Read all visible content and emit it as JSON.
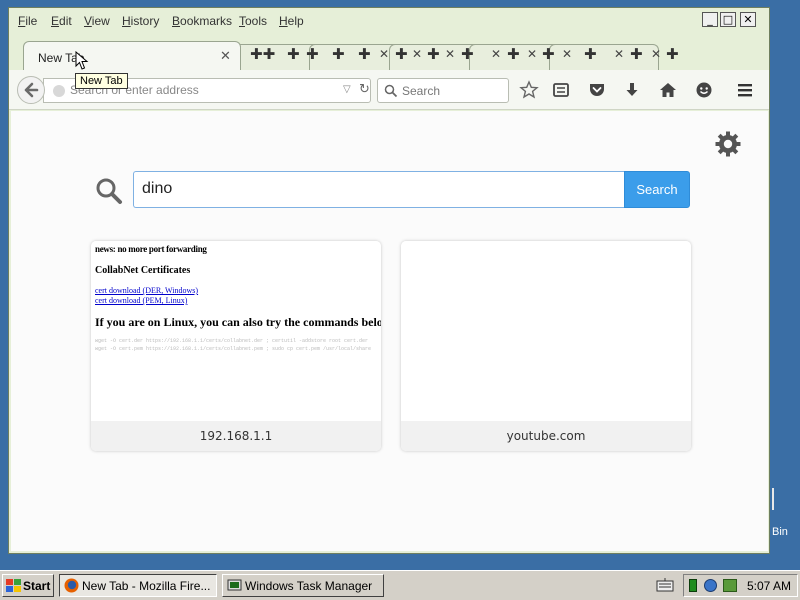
{
  "menu": [
    "File",
    "Edit",
    "View",
    "History",
    "Bookmarks",
    "Tools",
    "Help"
  ],
  "tabs": {
    "active_title": "New Tab",
    "tooltip": "New Tab"
  },
  "navbar": {
    "url_placeholder": "Search or enter address",
    "search_placeholder": "Search"
  },
  "newtab": {
    "search_value": "dino",
    "search_button": "Search",
    "tiles": [
      {
        "caption": "192.168.1.1",
        "thumb": {
          "news": "news: no more port forwarding",
          "heading": "CollabNet Certificates",
          "link1": "cert download (DER, Windows)",
          "link2": "cert download (PEM, Linux)",
          "big": "If you are on Linux, you can also try the commands below"
        }
      },
      {
        "caption": "youtube.com"
      }
    ]
  },
  "desktop": {
    "recycle_label": "Bin"
  },
  "taskbar": {
    "start_label": "Start",
    "tasks": [
      "New Tab - Mozilla Fire...",
      "Windows Task Manager"
    ],
    "clock": "5:07 AM"
  },
  "colors": {
    "desktop": "#3a6ea5",
    "search_button": "#3b9dea",
    "window_frame": "#e6efd8"
  },
  "icons": [
    "back-arrow-icon",
    "reload-icon",
    "search-icon",
    "bookmark-star-icon",
    "reading-list-icon",
    "pocket-icon",
    "download-icon",
    "home-icon",
    "hello-icon",
    "menu-icon",
    "gear-icon"
  ]
}
